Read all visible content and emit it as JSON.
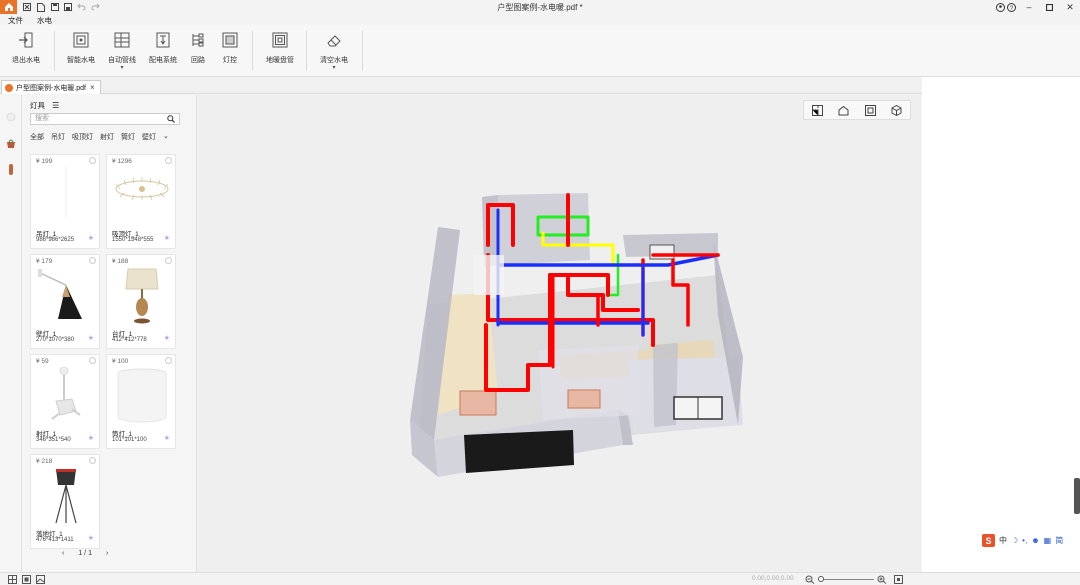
{
  "window": {
    "title": "户型图案例-水电暖.pdf *"
  },
  "menu": {
    "file": "文件",
    "water_electric": "水电"
  },
  "ribbon": {
    "exit_label": "退出水电",
    "smart_label": "智能水电",
    "auto_pipe_label": "自动管线",
    "distribution_label": "配电系统",
    "loop_label": "回路",
    "light_control_label": "灯控",
    "floor_heating_label": "地暖盘管",
    "clear_label": "清空水电"
  },
  "doc_tab": {
    "label": "户型图案例-水电暖.pdf"
  },
  "panel": {
    "title": "灯具",
    "search_placeholder": "搜索",
    "categories": [
      "全部",
      "吊灯",
      "吸顶灯",
      "射灯",
      "筒灯",
      "壁灯"
    ],
    "items": [
      {
        "price": "¥ 199",
        "name": "吊灯_1",
        "dim": "986*986*2625"
      },
      {
        "price": "¥ 1296",
        "name": "吸顶灯_1",
        "dim": "1550*1548*555"
      },
      {
        "price": "¥ 179",
        "name": "壁灯_1",
        "dim": "270*1070*380"
      },
      {
        "price": "¥ 188",
        "name": "台灯_1",
        "dim": "412*412*778"
      },
      {
        "price": "¥ 59",
        "name": "射灯_1",
        "dim": "346*351*540"
      },
      {
        "price": "¥ 100",
        "name": "筒灯_1",
        "dim": "101*101*100"
      },
      {
        "price": "¥ 218",
        "name": "落地灯_1",
        "dim": "476*413*1411"
      }
    ],
    "pager": {
      "text": "1 / 1"
    }
  },
  "statusbar": {
    "coords": "0.00,0.00,0.00"
  },
  "ime": {
    "lang": "中",
    "mode": "简"
  },
  "colors": {
    "accent": "#e8742a",
    "pipe_hot": "#ff0000",
    "pipe_cold": "#1a2eff",
    "pipe_green": "#22ee22",
    "pipe_yellow": "#ffff00"
  }
}
